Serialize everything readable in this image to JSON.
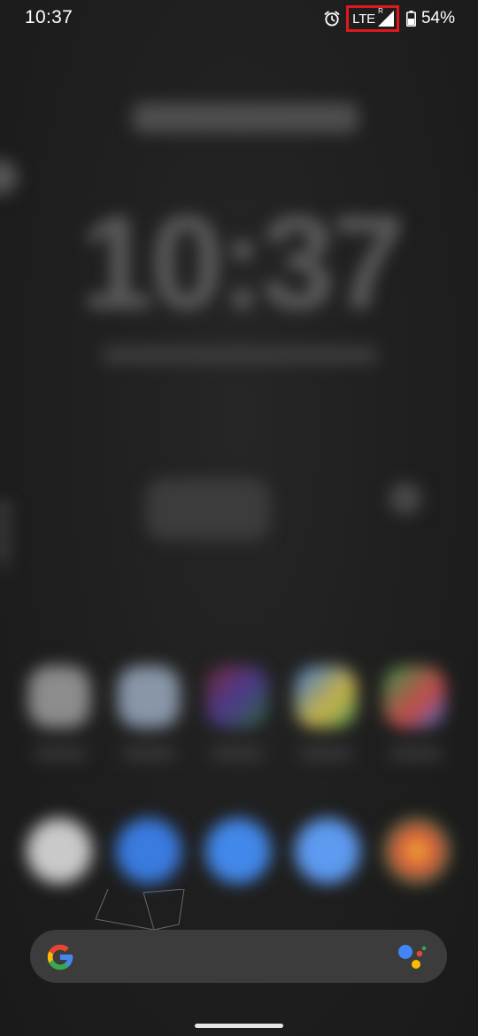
{
  "status_bar": {
    "time": "10:37",
    "network_type": "LTE",
    "roaming_indicator": "R",
    "battery_percent": "54%",
    "icons": [
      "alarm-icon",
      "signal-icon",
      "battery-icon"
    ],
    "highlight_color": "#e0181c"
  },
  "search_bar": {
    "placeholder": "",
    "icons": [
      "google-g-icon",
      "assistant-icon"
    ]
  },
  "home_screen": {
    "clock_text": "10:37"
  },
  "colors": {
    "background": "#1f1f1f",
    "search_bar": "#3c3c3d",
    "google_blue": "#4285F4",
    "google_red": "#EA4335",
    "google_yellow": "#FBBC05",
    "google_green": "#34A853"
  }
}
